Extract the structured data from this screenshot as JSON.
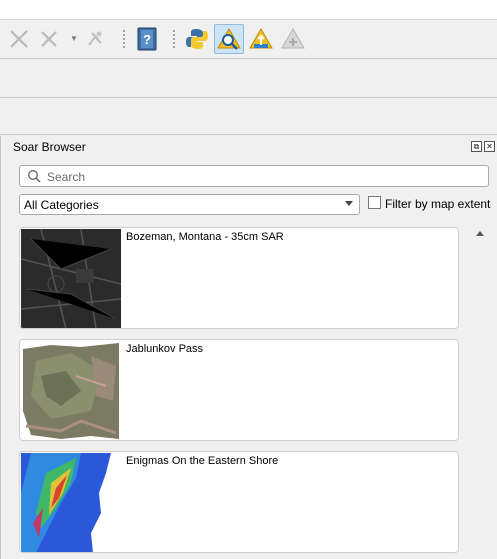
{
  "toolbar": {
    "icons": [
      "close-x-icon",
      "pin-icon",
      "dropdown-arrow-icon",
      "satellite-icon",
      "help-book-icon",
      "python-icon",
      "soar-browse-icon",
      "soar-upload-icon",
      "soar-disabled-icon"
    ],
    "help_glyph": "?"
  },
  "dock": {
    "title": "Soar Browser",
    "float_glyph": "⧉",
    "close_glyph": "✕"
  },
  "search": {
    "placeholder": "Search",
    "value": ""
  },
  "category": {
    "selected": "All Categories"
  },
  "filter": {
    "label": "Filter by map extent",
    "checked": false
  },
  "results": [
    {
      "title": "Bozeman, Montana - 35cm SAR"
    },
    {
      "title": "Jablunkov Pass"
    },
    {
      "title": "Enigmas On the Eastern Shore"
    }
  ],
  "colors": {
    "accent": "#cde4f7",
    "panel": "#f0f0f0",
    "border": "#a9a9a9"
  }
}
